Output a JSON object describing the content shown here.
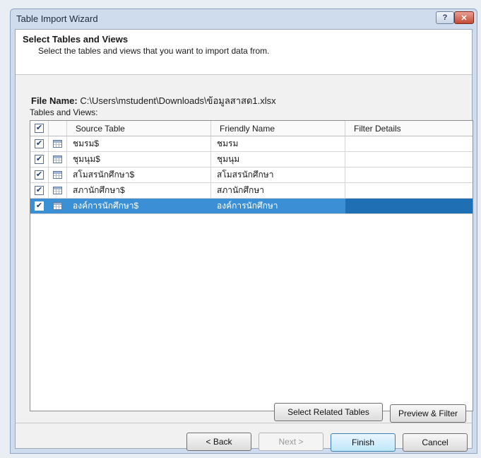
{
  "window": {
    "title": "Table Import Wizard",
    "help_label": "?",
    "close_label": "✕"
  },
  "header": {
    "title": "Select Tables and Views",
    "description": "Select the tables and views that you want to import data from."
  },
  "file": {
    "label": "File Name:",
    "path": "C:\\Users\\mstudent\\Downloads\\ข้อมูลสาสด1.xlsx"
  },
  "tables_label": "Tables and Views:",
  "columns": {
    "source": "Source Table",
    "friendly": "Friendly Name",
    "filter": "Filter Details"
  },
  "rows": [
    {
      "checked": true,
      "source": "ชมรม$",
      "friendly": "ชมรม",
      "filter": "",
      "selected": false
    },
    {
      "checked": true,
      "source": "ชุมนุม$",
      "friendly": "ชุมนุม",
      "filter": "",
      "selected": false
    },
    {
      "checked": true,
      "source": "สโมสรนักศึกษา$",
      "friendly": "สโมสรนักศึกษา",
      "filter": "",
      "selected": false
    },
    {
      "checked": true,
      "source": "สภานักศึกษา$",
      "friendly": "สภานักศึกษา",
      "filter": "",
      "selected": false
    },
    {
      "checked": true,
      "source": "องค์การนักศึกษา$",
      "friendly": "องค์การนักศึกษา",
      "filter": "",
      "selected": true
    }
  ],
  "buttons": {
    "select_related": "Select Related Tables",
    "preview_filter": "Preview & Filter",
    "back": "< Back",
    "next": "Next >",
    "finish": "Finish",
    "cancel": "Cancel"
  },
  "colors": {
    "selection": "#3b8fd4",
    "window_frame": "#cfdced"
  }
}
